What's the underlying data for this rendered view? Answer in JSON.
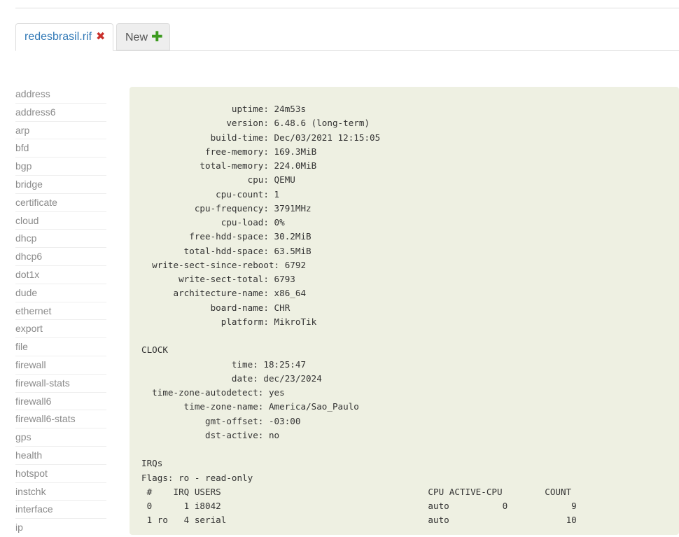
{
  "tabs": [
    {
      "label": "redesbrasil.rif",
      "active": true
    },
    {
      "label": "New",
      "active": false
    }
  ],
  "sidebar": {
    "items": [
      "address",
      "address6",
      "arp",
      "bfd",
      "bgp",
      "bridge",
      "certificate",
      "cloud",
      "dhcp",
      "dhcp6",
      "dot1x",
      "dude",
      "ethernet",
      "export",
      "file",
      "firewall",
      "firewall-stats",
      "firewall6",
      "firewall6-stats",
      "gps",
      "health",
      "hotspot",
      "instchk",
      "interface",
      "ip"
    ]
  },
  "output": {
    "text": "                 uptime: 24m53s\n                version: 6.48.6 (long-term)\n             build-time: Dec/03/2021 12:15:05\n            free-memory: 169.3MiB\n           total-memory: 224.0MiB\n                    cpu: QEMU\n              cpu-count: 1\n          cpu-frequency: 3791MHz\n               cpu-load: 0%\n         free-hdd-space: 30.2MiB\n        total-hdd-space: 63.5MiB\n  write-sect-since-reboot: 6792\n       write-sect-total: 6793\n      architecture-name: x86_64\n             board-name: CHR\n               platform: MikroTik\n\nCLOCK\n                 time: 18:25:47\n                 date: dec/23/2024\n  time-zone-autodetect: yes\n        time-zone-name: America/Sao_Paulo\n            gmt-offset: -03:00\n            dst-active: no\n\nIRQs\nFlags: ro - read-only\n #    IRQ USERS                                       CPU ACTIVE-CPU        COUNT\n 0      1 i8042                                       auto          0            9\n 1 ro   4 serial                                      auto                      10"
  }
}
